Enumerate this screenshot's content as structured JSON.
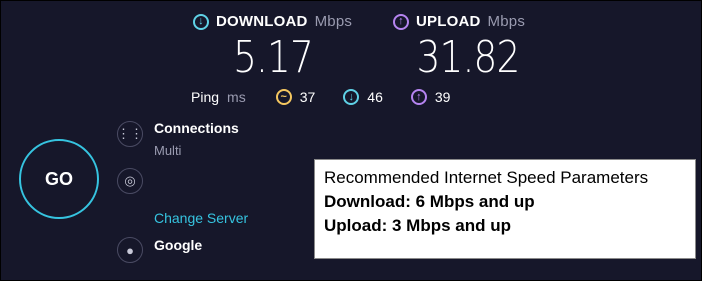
{
  "download": {
    "icon": "download-arrow-icon",
    "label": "DOWNLOAD",
    "unit": "Mbps",
    "value": "5.17"
  },
  "upload": {
    "icon": "upload-arrow-icon",
    "label": "UPLOAD",
    "unit": "Mbps",
    "value": "31.82"
  },
  "ping": {
    "label": "Ping",
    "unit": "ms",
    "jitter_icon": "jitter-icon",
    "jitter": "37",
    "down_icon": "download-arrow-icon",
    "down": "46",
    "up_icon": "upload-arrow-icon",
    "up": "39"
  },
  "go_button": {
    "label": "GO"
  },
  "connections": {
    "icon": "connections-icon",
    "label": "Connections",
    "value": "Multi"
  },
  "server": {
    "icon": "globe-icon",
    "change_label": "Change Server"
  },
  "provider": {
    "icon": "user-icon",
    "label": "Google"
  },
  "note": {
    "title": "Recommended Internet Speed Parameters",
    "download": "Download: 6 Mbps and up",
    "upload": "Upload: 3 Mbps and up"
  },
  "colors": {
    "background": "#16172a",
    "download": "#5fd1e6",
    "upload": "#b584f0",
    "jitter": "#f5c760",
    "accent": "#36c4e0"
  }
}
